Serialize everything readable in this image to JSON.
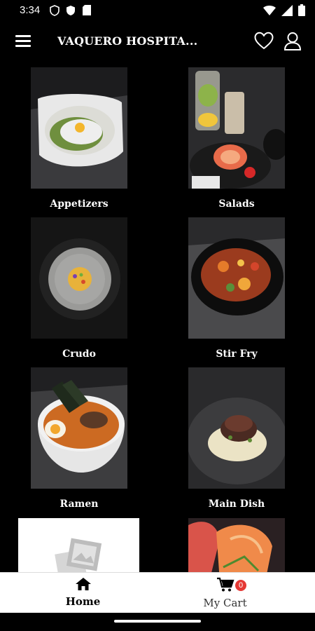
{
  "status_bar": {
    "time": "3:34"
  },
  "app_bar": {
    "title": "VAQUERO HOSPITA..."
  },
  "categories": [
    {
      "label": "Appetizers"
    },
    {
      "label": "Salads"
    },
    {
      "label": "Crudo"
    },
    {
      "label": "Stir Fry"
    },
    {
      "label": "Ramen"
    },
    {
      "label": "Main Dish"
    }
  ],
  "bottom_nav": {
    "home_label": "Home",
    "cart_label": "My Cart",
    "cart_count": "0"
  },
  "colors": {
    "accent": "#e53935",
    "background": "#000000"
  }
}
